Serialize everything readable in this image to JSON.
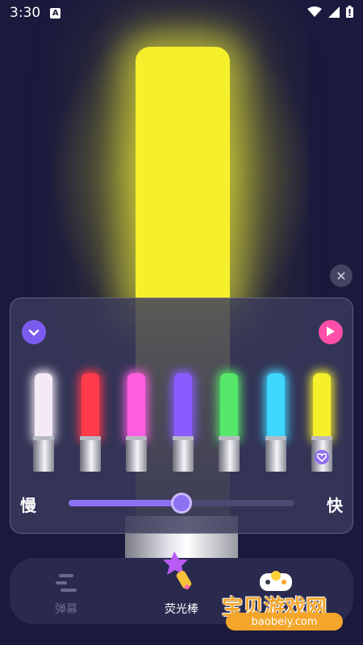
{
  "status_bar": {
    "time": "3:30",
    "notification_badge": "A",
    "icons": [
      "wifi-icon",
      "signal-icon",
      "battery-icon"
    ]
  },
  "glow_stick": {
    "color": "#f6ef2c"
  },
  "panel": {
    "collapse_icon": "chevron-down-icon",
    "play_icon": "play-icon",
    "colors": [
      {
        "name": "white",
        "color": "#f4eaf6"
      },
      {
        "name": "red",
        "color": "#ff3a4a"
      },
      {
        "name": "pink",
        "color": "#ff5ee0"
      },
      {
        "name": "purple",
        "color": "#8a5cff"
      },
      {
        "name": "green",
        "color": "#55e86a"
      },
      {
        "name": "cyan",
        "color": "#3fd6ff"
      },
      {
        "name": "yellow",
        "color": "#f6ef2c",
        "selected": true
      }
    ],
    "speed": {
      "slow_label": "慢",
      "fast_label": "快",
      "value": 0.5
    }
  },
  "bottom_nav": {
    "items": [
      {
        "label": "弹幕",
        "icon": "danmaku-icon",
        "active": false
      },
      {
        "label": "荧光棒",
        "icon": "glow-wand-icon",
        "active": true
      }
    ]
  },
  "watermark": {
    "title": "宝贝游戏网",
    "url": "baobeiy.com"
  },
  "accent": "#8e72f4"
}
